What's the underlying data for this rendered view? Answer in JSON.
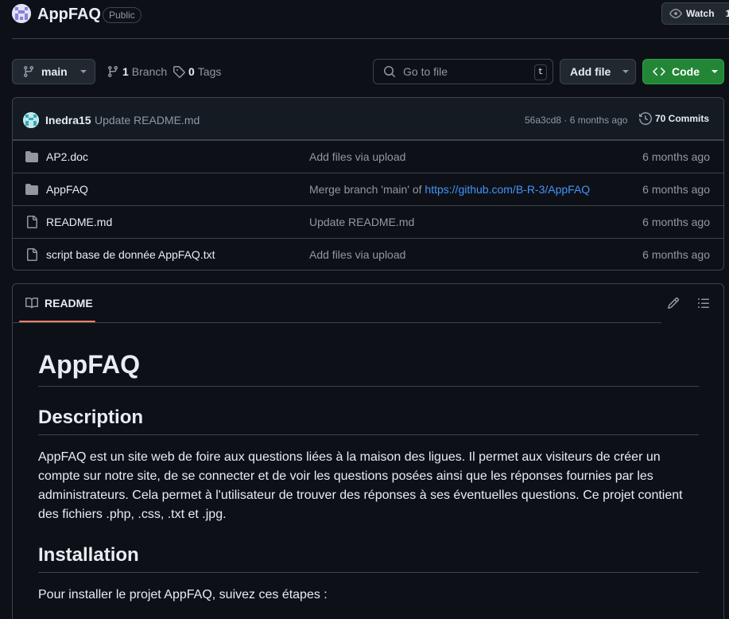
{
  "repo": {
    "name": "AppFAQ",
    "visibility": "Public",
    "watch_label": "Watch",
    "watch_count": "1"
  },
  "toolbar": {
    "branch": "main",
    "branches_count": "1",
    "branches_label": "Branch",
    "tags_count": "0",
    "tags_label": "Tags",
    "goto_placeholder": "Go to file",
    "goto_shortcut": "t",
    "add_file_label": "Add file",
    "code_label": "Code"
  },
  "latest_commit": {
    "author": "Inedra15",
    "message": "Update README.md",
    "meta": "56a3cd8 · 6 months ago",
    "commits_label": "70 Commits"
  },
  "files": [
    {
      "type": "folder",
      "name": "AP2.doc",
      "message": "Add files via upload",
      "link": "",
      "date": "6 months ago"
    },
    {
      "type": "folder",
      "name": "AppFAQ",
      "message": "Merge branch 'main' of ",
      "link": "https://github.com/B-R-3/AppFAQ",
      "date": "6 months ago"
    },
    {
      "type": "file",
      "name": "README.md",
      "message": "Update README.md",
      "link": "",
      "date": "6 months ago"
    },
    {
      "type": "file",
      "name": "script base de donnée AppFAQ.txt",
      "message": "Add files via upload",
      "link": "",
      "date": "6 months ago"
    }
  ],
  "readme": {
    "tab_label": "README",
    "title": "AppFAQ",
    "h_description": "Description",
    "description": "AppFAQ est un site web de foire aux questions liées à la maison des ligues. Il permet aux visiteurs de créer un compte sur notre site, de se connecter et de voir les questions posées ainsi que les réponses fournies par les administrateurs. Cela permet à l'utilisateur de trouver des réponses à ses éventuelles questions. Ce projet contient des fichiers .php, .css, .txt et .jpg.",
    "h_installation": "Installation",
    "install_intro": "Pour installer le projet AppFAQ, suivez ces étapes :"
  },
  "colors": {
    "background": "#0d1117",
    "border": "#3d444d",
    "accent_green": "#238636",
    "link_blue": "#4493f8",
    "tab_underline": "#f78166"
  }
}
